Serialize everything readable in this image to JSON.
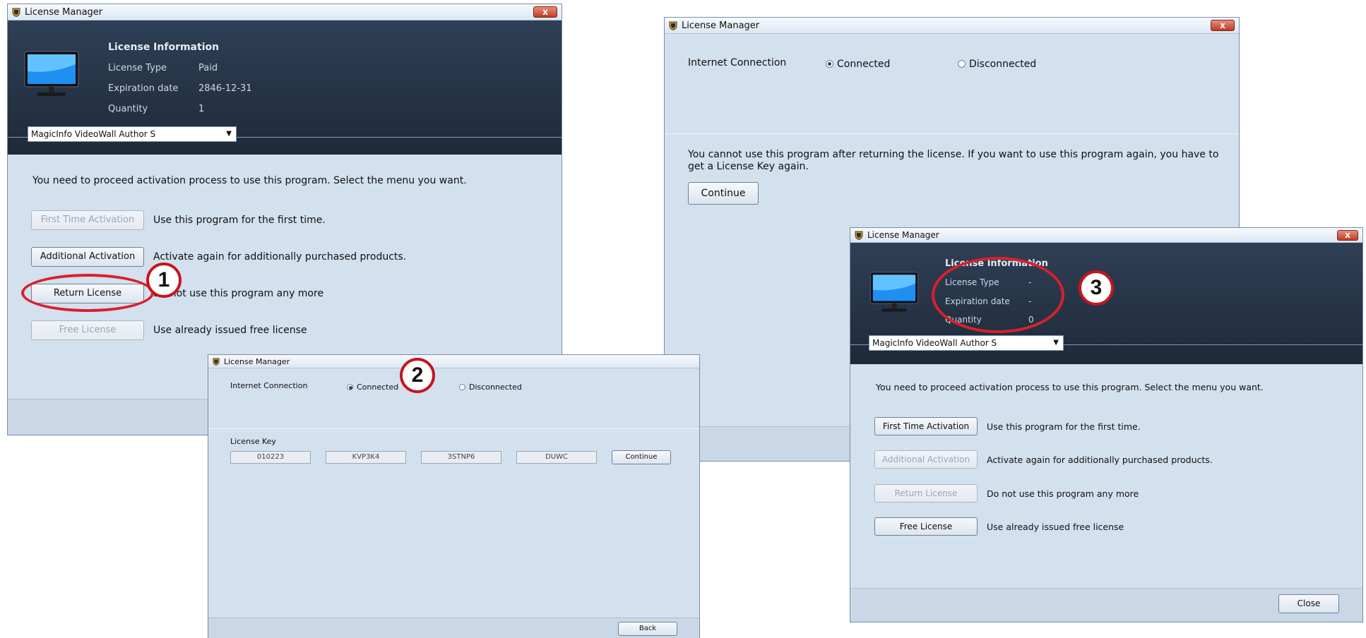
{
  "win1": {
    "title": "License Manager",
    "close": "x",
    "info_title": "License Information",
    "type_label": "License Type",
    "type_value": "Paid",
    "exp_label": "Expiration date",
    "exp_value": "2846-12-31",
    "qty_label": "Quantity",
    "qty_value": "1",
    "product": "MagicInfo VideoWall Author S",
    "instruction": "You need to proceed activation process to use this program. Select the menu you want.",
    "buttons": [
      {
        "label": "First Time Activation",
        "desc": "Use this program for the first time.",
        "enabled": false
      },
      {
        "label": "Additional Activation",
        "desc": "Activate again for additionally purchased products.",
        "enabled": true
      },
      {
        "label": "Return License",
        "desc": "Do not use this program any more",
        "enabled": true
      },
      {
        "label": "Free License",
        "desc": "Use already issued free license",
        "enabled": false
      }
    ]
  },
  "win2": {
    "title": "License Manager",
    "close": "x",
    "internet_label": "Internet Connection",
    "connected": "Connected",
    "disconnected": "Disconnected",
    "message": "You cannot use this program after returning the license. If you want to use this program again, you have to get a License Key again.",
    "continue": "Continue"
  },
  "win3": {
    "title": "License Manager",
    "internet_label": "Internet Connection",
    "connected": "Connected",
    "disconnected": "Disconnected",
    "key_label": "License Key",
    "keys": [
      "010223",
      "KVP3K4",
      "3STNP6",
      "DUWC"
    ],
    "continue": "Continue",
    "back": "Back"
  },
  "win4": {
    "title": "License Manager",
    "close": "x",
    "info_title": "License Information",
    "type_label": "License Type",
    "type_value": "-",
    "exp_label": "Expiration date",
    "exp_value": "-",
    "qty_label": "Quantity",
    "qty_value": "0",
    "product": "MagicInfo VideoWall Author S",
    "instruction": "You need to proceed activation process to use this program. Select the menu you want.",
    "buttons": [
      {
        "label": "First Time Activation",
        "desc": "Use this program for the first time.",
        "enabled": true
      },
      {
        "label": "Additional Activation",
        "desc": "Activate again for additionally purchased products.",
        "enabled": false
      },
      {
        "label": "Return License",
        "desc": "Do not use this program any more",
        "enabled": false
      },
      {
        "label": "Free License",
        "desc": "Use already issued free license",
        "enabled": true
      }
    ],
    "close_label": "Close"
  },
  "callouts": [
    "1",
    "2",
    "3"
  ],
  "colors": {
    "accent_ring": "#d9202b",
    "panel_dark": "#1e2a3a",
    "window_bg": "#d3e0ee"
  }
}
